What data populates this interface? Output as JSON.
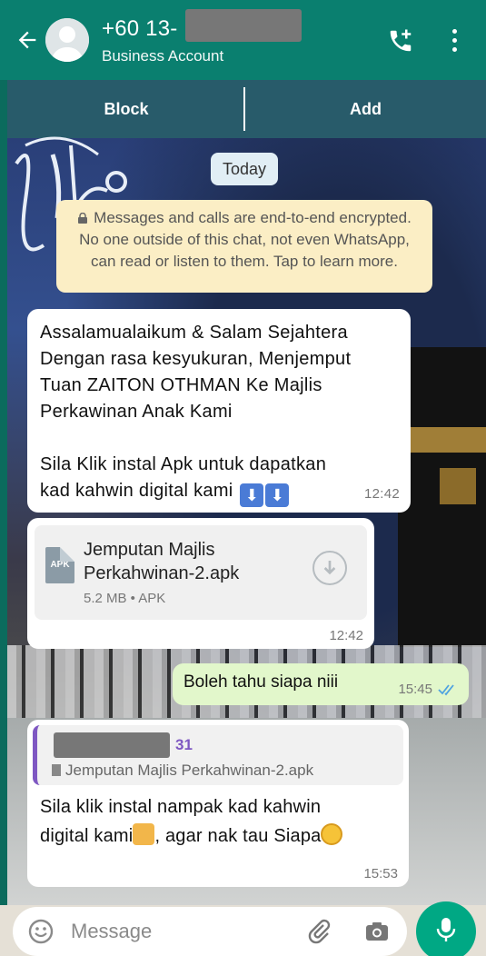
{
  "header": {
    "title": "+60 13-",
    "subtitle": "Business Account"
  },
  "actions": {
    "block": "Block",
    "add": "Add"
  },
  "chat": {
    "date_chip": "Today",
    "encryption_notice": "Messages and calls are end-to-end encrypted. No one outside of this chat, not even WhatsApp, can read or listen to them. Tap to learn more.",
    "messages": [
      {
        "lines": [
          "Assalamualaikum & Salam Sejahtera",
          "Dengan rasa kesyukuran, Menjemput",
          "Tuan ZAITON OTHMAN Ke Majlis",
          "Perkawinan Anak Kami",
          "",
          "Sila Klik instal Apk  untuk dapatkan",
          "kad kahwin digital kami"
        ],
        "time": "12:42"
      },
      {
        "file_icon_label": "APK",
        "file_name": "Jemputan Majlis Perkahwinan-2.apk",
        "file_meta": "5.2 MB • APK",
        "time": "12:42"
      },
      {
        "text": "Boleh tahu siapa niii",
        "time": "15:45"
      },
      {
        "quote_author": "31",
        "quote_file": "Jemputan Majlis Perkahwinan-2.apk",
        "line1": "Sila klik instal nampak kad kahwin",
        "line2_a": "digital kami",
        "line2_b": ", agar nak tau Siapa",
        "time": "15:53"
      }
    ]
  },
  "input": {
    "placeholder": "Message"
  },
  "colors": {
    "header_bg": "#0a7f6f",
    "outgoing_bubble": "#e2f7cb",
    "incoming_bubble": "#ffffff",
    "mic_button": "#00a884",
    "quote_accent": "#7e57c2"
  }
}
